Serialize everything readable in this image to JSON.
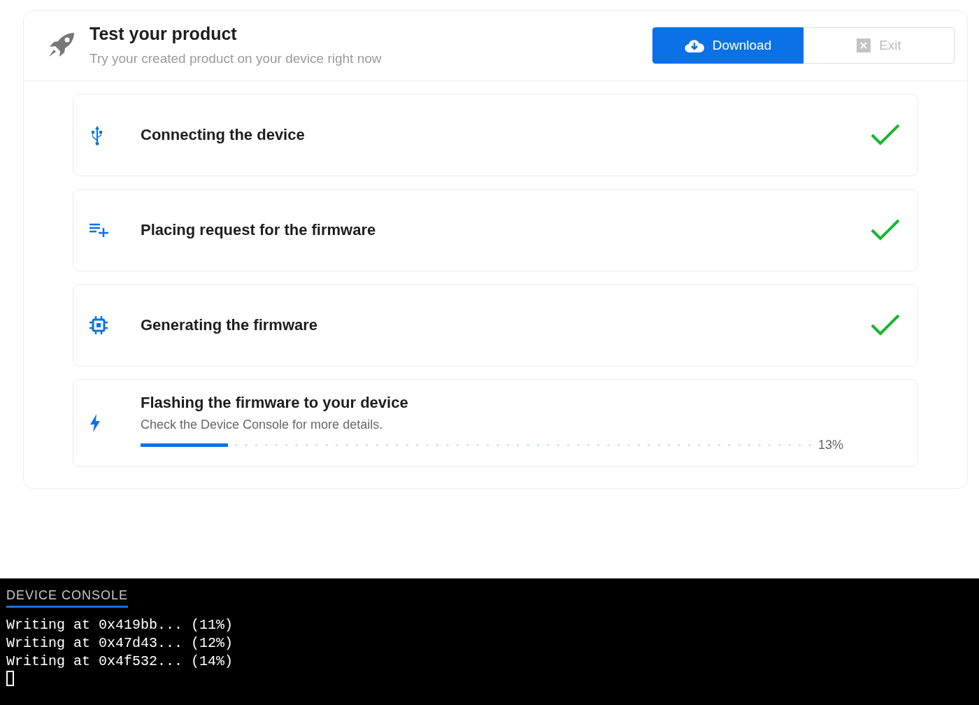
{
  "header": {
    "title": "Test your product",
    "subtitle": "Try your created product on your device right now"
  },
  "buttons": [
    {
      "label": "Download",
      "kind": "primary",
      "disabled": false
    },
    {
      "label": "Exit",
      "kind": "secondary",
      "disabled": true
    }
  ],
  "steps": [
    {
      "kind": "usb",
      "title": "Connecting the device",
      "done": true
    },
    {
      "kind": "queue",
      "title": "Placing request for the firmware",
      "done": true
    },
    {
      "kind": "chip",
      "title": "Generating the firmware",
      "done": true
    },
    {
      "kind": "flash",
      "title": "Flashing the firmware to your device",
      "done": false,
      "subtitle": "Check the Device Console for more details.",
      "level": 0.13,
      "reading": "13%"
    }
  ],
  "console": {
    "title": "DEVICE CONSOLE",
    "lines": [
      "Writing at 0x419bb... (11%)",
      "Writing at 0x47d43... (12%)",
      "Writing at 0x4f532... (14%)"
    ],
    "cursor": true
  }
}
